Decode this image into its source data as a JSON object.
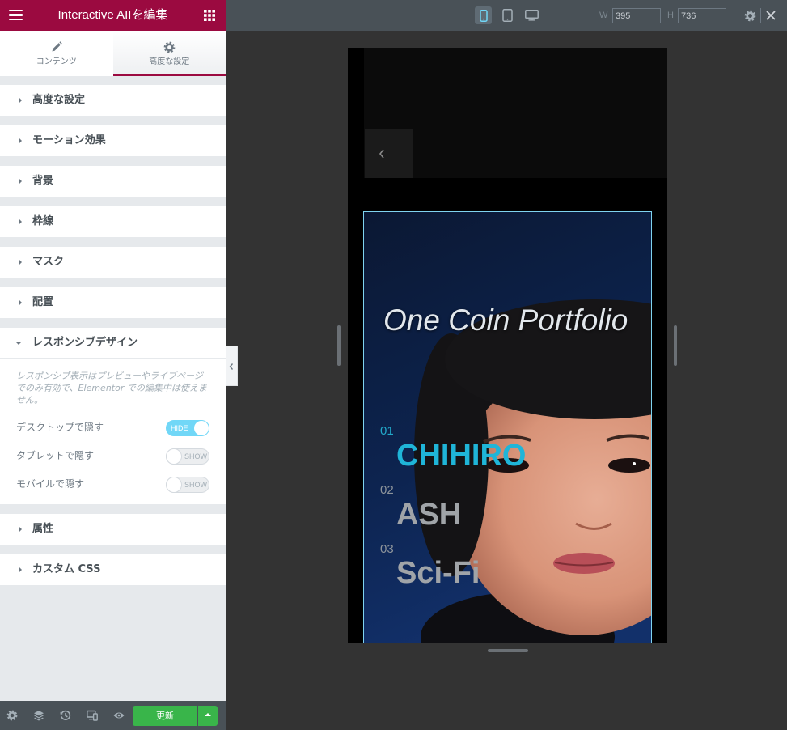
{
  "panel": {
    "title": "Interactive AIIを編集",
    "tabs": [
      {
        "label": "コンテンツ",
        "icon": "pencil-icon"
      },
      {
        "label": "高度な設定",
        "icon": "gear-icon"
      }
    ],
    "sections_top": [
      {
        "label": "高度な設定"
      },
      {
        "label": "モーション効果"
      },
      {
        "label": "背景"
      },
      {
        "label": "枠線"
      },
      {
        "label": "マスク"
      },
      {
        "label": "配置"
      }
    ],
    "responsive": {
      "label": "レスポンシブデザイン",
      "note": "レスポンシブ表示はプレビューやライブページでのみ有効で、Elementor での編集中は使えません。",
      "toggles": [
        {
          "label": "デスクトップで隠す",
          "state": "HIDE",
          "on": true
        },
        {
          "label": "タブレットで隠す",
          "state": "SHOW",
          "on": false
        },
        {
          "label": "モバイルで隠す",
          "state": "SHOW",
          "on": false
        }
      ]
    },
    "sections_bottom": [
      {
        "label": "属性"
      },
      {
        "label": "カスタム CSS"
      }
    ],
    "footer": {
      "icons": [
        "gear-icon",
        "layers-icon",
        "history-icon",
        "responsive-icon",
        "eye-icon"
      ],
      "update_label": "更新"
    }
  },
  "toolbar": {
    "devices": [
      {
        "icon": "mobile-icon",
        "active": true
      },
      {
        "icon": "tablet-icon",
        "active": false
      },
      {
        "icon": "desktop-icon",
        "active": false
      }
    ],
    "width_label": "W",
    "width_value": "395",
    "height_label": "H",
    "height_value": "736"
  },
  "preview": {
    "heading": "One Coin Portfolio",
    "items": [
      {
        "number": "01",
        "name": "CHIHIRO",
        "active": true
      },
      {
        "number": "02",
        "name": "ASH",
        "active": false
      },
      {
        "number": "03",
        "name": "Sci-Fi",
        "active": false
      }
    ]
  },
  "colors": {
    "brand": "#9b0a40",
    "accent": "#71d7f7",
    "update_button": "#39b54a",
    "active_item": "#1fb5d8",
    "inactive_item": "#a0a4a8"
  }
}
